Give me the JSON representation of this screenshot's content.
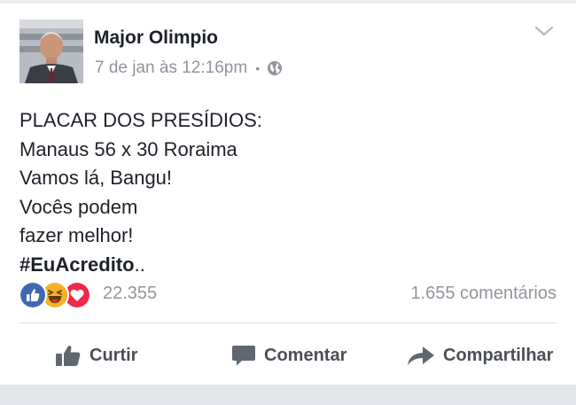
{
  "post": {
    "author": "Major Olimpio",
    "timestamp": "7 de jan às 12:16pm",
    "separator": "•",
    "audience_icon": "globe-icon",
    "lines": [
      "PLACAR DOS PRESÍDIOS:",
      "Manaus 56 x 30 Roraima",
      "Vamos lá, Bangu!",
      "Vocês podem",
      "fazer melhor!"
    ],
    "hashtag": "#EuAcredito",
    "hashtag_suffix": ".."
  },
  "engagement": {
    "reactions": [
      "like-reaction-icon",
      "haha-reaction-icon",
      "love-reaction-icon"
    ],
    "reaction_count": "22.355",
    "comment_count": "1.655 comentários"
  },
  "actions": {
    "like": "Curtir",
    "comment": "Comentar",
    "share": "Compartilhar"
  },
  "colors": {
    "like_blue": "#4267b2",
    "love_red": "#f0284a",
    "haha_yellow": "#f7b125",
    "muted_text": "#90949c",
    "action_text": "#4b4f56"
  }
}
